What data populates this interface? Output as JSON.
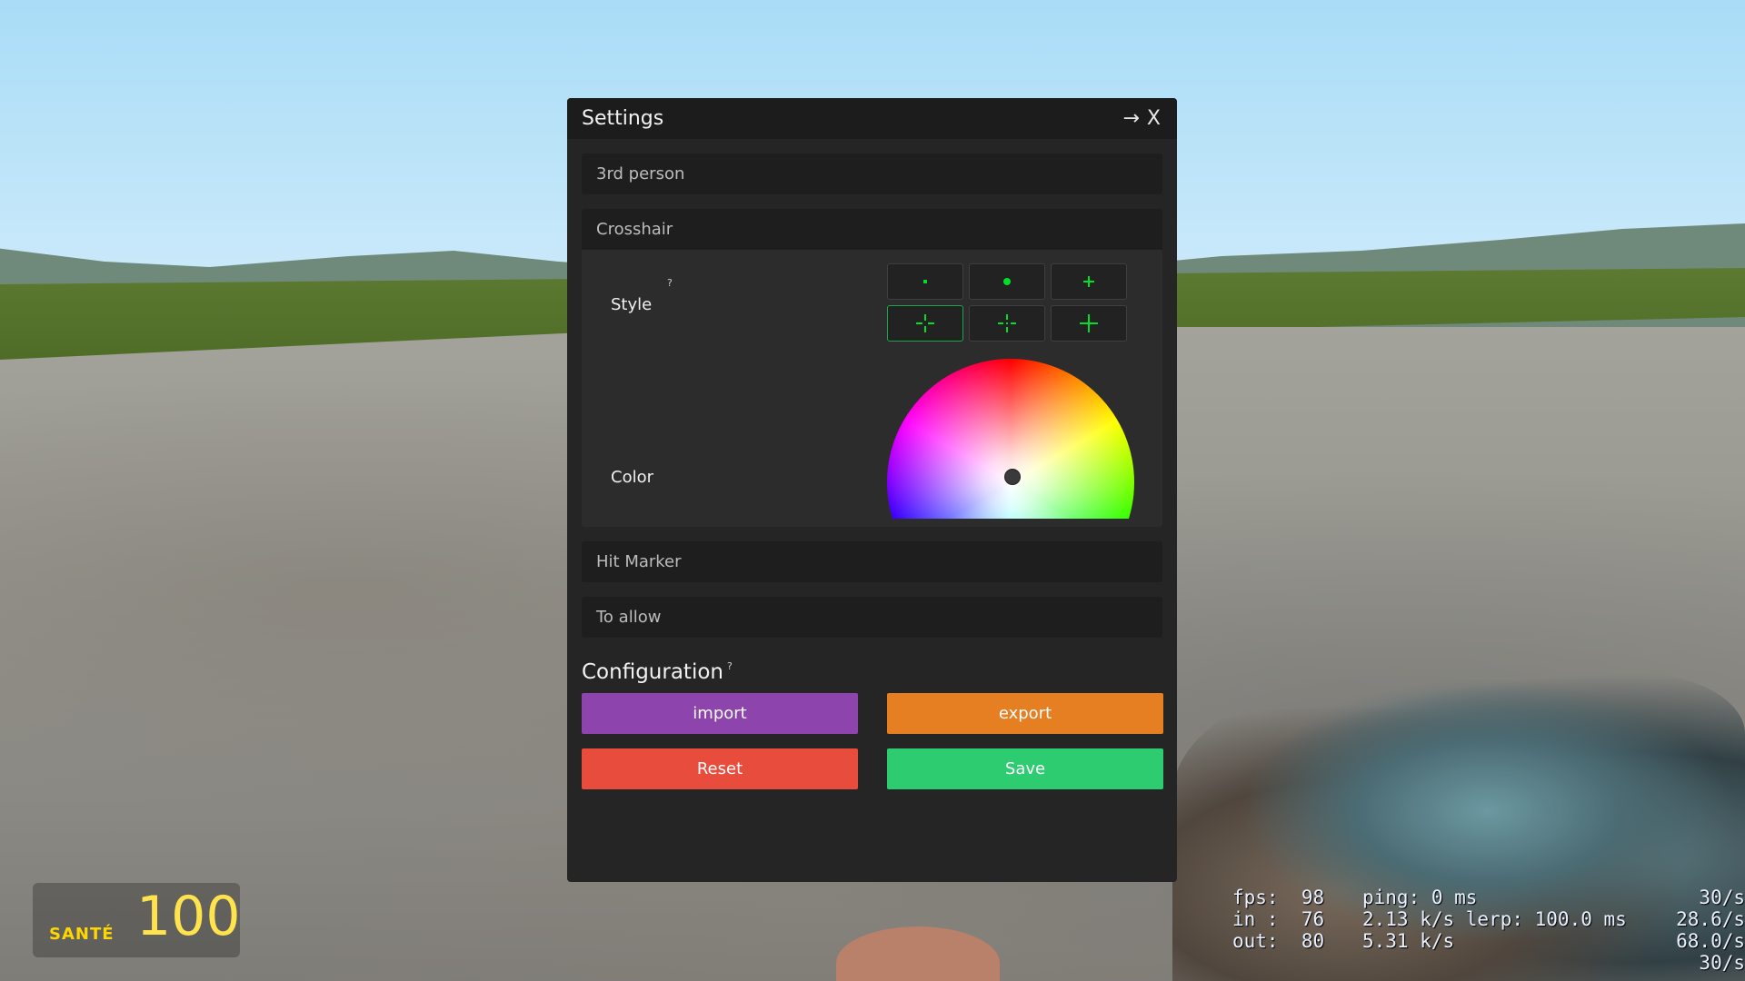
{
  "window": {
    "title": "Settings",
    "arrow_icon": "→",
    "close_label": "X"
  },
  "sections": {
    "third_person": "3rd person",
    "crosshair": "Crosshair",
    "hit_marker": "Hit Marker",
    "to_allow": "To allow"
  },
  "crosshair": {
    "style_label": "Style",
    "color_label": "Color",
    "help_mark": "?",
    "style_options": [
      "small-dot",
      "large-dot",
      "small-cross",
      "gap-cross",
      "gap-cross-dot",
      "large-cross"
    ],
    "selected_style": "gap-cross",
    "crosshair_color": "#00e02a",
    "selected_color": "#3a3a3a"
  },
  "configuration": {
    "title": "Configuration",
    "help_mark": "?",
    "import_label": "import",
    "export_label": "export",
    "reset_label": "Reset",
    "save_label": "Save",
    "colors": {
      "import": "#8e44ad",
      "export": "#e67e22",
      "reset": "#e74c3c",
      "save": "#2ecc71"
    }
  },
  "hud": {
    "health_label": "SANTÉ",
    "health_value": "100",
    "netgraph": {
      "col1": "fps:  98\nin :  76\nout:  80",
      "col2": "ping: 0 ms\n2.13 k/s lerp: 100.0 ms\n5.31 k/s",
      "col3": "30/s\n28.6/s\n68.0/s\n30/s"
    }
  }
}
